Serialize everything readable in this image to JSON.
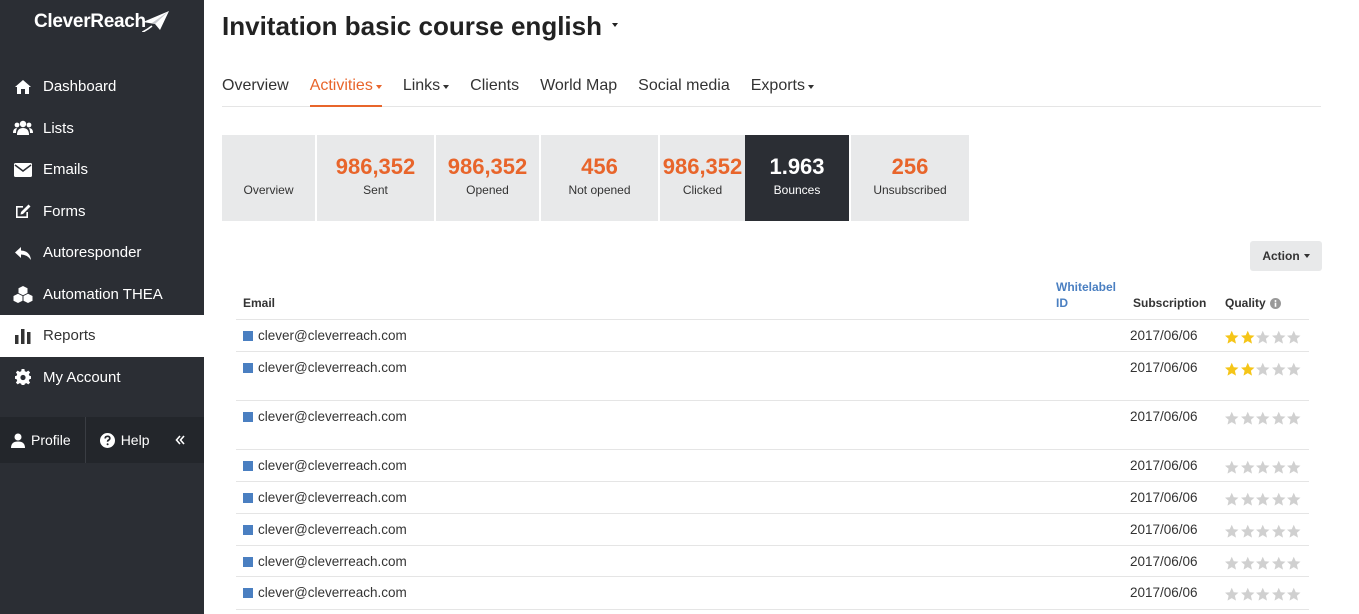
{
  "brand": {
    "name": "CleverReach"
  },
  "sidebar": {
    "items": [
      {
        "label": "Dashboard",
        "icon": "home-icon",
        "active": false
      },
      {
        "label": "Lists",
        "icon": "users-icon",
        "active": false
      },
      {
        "label": "Emails",
        "icon": "envelope-icon",
        "active": false
      },
      {
        "label": "Forms",
        "icon": "edit-icon",
        "active": false
      },
      {
        "label": "Autoresponder",
        "icon": "reply-icon",
        "active": false
      },
      {
        "label": "Automation THEA",
        "icon": "cubes-icon",
        "active": false
      },
      {
        "label": "Reports",
        "icon": "bar-chart-icon",
        "active": true
      },
      {
        "label": "My Account",
        "icon": "gear-icon",
        "active": false
      }
    ],
    "footer": {
      "profile_label": "Profile",
      "help_label": "Help"
    }
  },
  "page": {
    "title": "Invitation basic course english"
  },
  "tabs": [
    {
      "label": "Overview",
      "dropdown": false,
      "active": false
    },
    {
      "label": "Activities",
      "dropdown": true,
      "active": true
    },
    {
      "label": "Links",
      "dropdown": true,
      "active": false
    },
    {
      "label": "Clients",
      "dropdown": false,
      "active": false
    },
    {
      "label": "World Map",
      "dropdown": false,
      "active": false
    },
    {
      "label": "Social media",
      "dropdown": false,
      "active": false
    },
    {
      "label": "Exports",
      "dropdown": true,
      "active": false
    }
  ],
  "stat_cards": [
    {
      "value": "",
      "label": "Overview",
      "selected": false
    },
    {
      "value": "986,352",
      "label": "Sent",
      "selected": false
    },
    {
      "value": "986,352",
      "label": "Opened",
      "selected": false
    },
    {
      "value": "456",
      "label": "Not opened",
      "selected": false
    },
    {
      "value": "986,352",
      "label": "Clicked",
      "selected": false
    },
    {
      "value": "1.963",
      "label": "Bounces",
      "selected": true
    },
    {
      "value": "256",
      "label": "Unsubscribed",
      "selected": false
    }
  ],
  "action_button": {
    "label": "Action"
  },
  "table": {
    "columns": {
      "email": "Email",
      "whitelabel_line1": "Whitelabel",
      "whitelabel_line2": "ID",
      "subscription": "Subscription",
      "quality": "Quality"
    },
    "rows": [
      {
        "email": "clever@cleverreach.com",
        "subscription": "2017/06/06",
        "quality": 2
      },
      {
        "email": "clever@cleverreach.com",
        "subscription": "2017/06/06",
        "quality": 2
      },
      {
        "email": "clever@cleverreach.com",
        "subscription": "2017/06/06",
        "quality": 0
      },
      {
        "email": "clever@cleverreach.com",
        "subscription": "2017/06/06",
        "quality": 0
      },
      {
        "email": "clever@cleverreach.com",
        "subscription": "2017/06/06",
        "quality": 0
      },
      {
        "email": "clever@cleverreach.com",
        "subscription": "2017/06/06",
        "quality": 0
      },
      {
        "email": "clever@cleverreach.com",
        "subscription": "2017/06/06",
        "quality": 0
      },
      {
        "email": "clever@cleverreach.com",
        "subscription": "2017/06/06",
        "quality": 0
      }
    ],
    "max_quality": 5
  },
  "colors": {
    "accent": "#e8652b",
    "sidebar": "#2b2e34",
    "link": "#4a7fc1",
    "star_on": "#f5c518",
    "star_off": "#d0d0d0"
  }
}
